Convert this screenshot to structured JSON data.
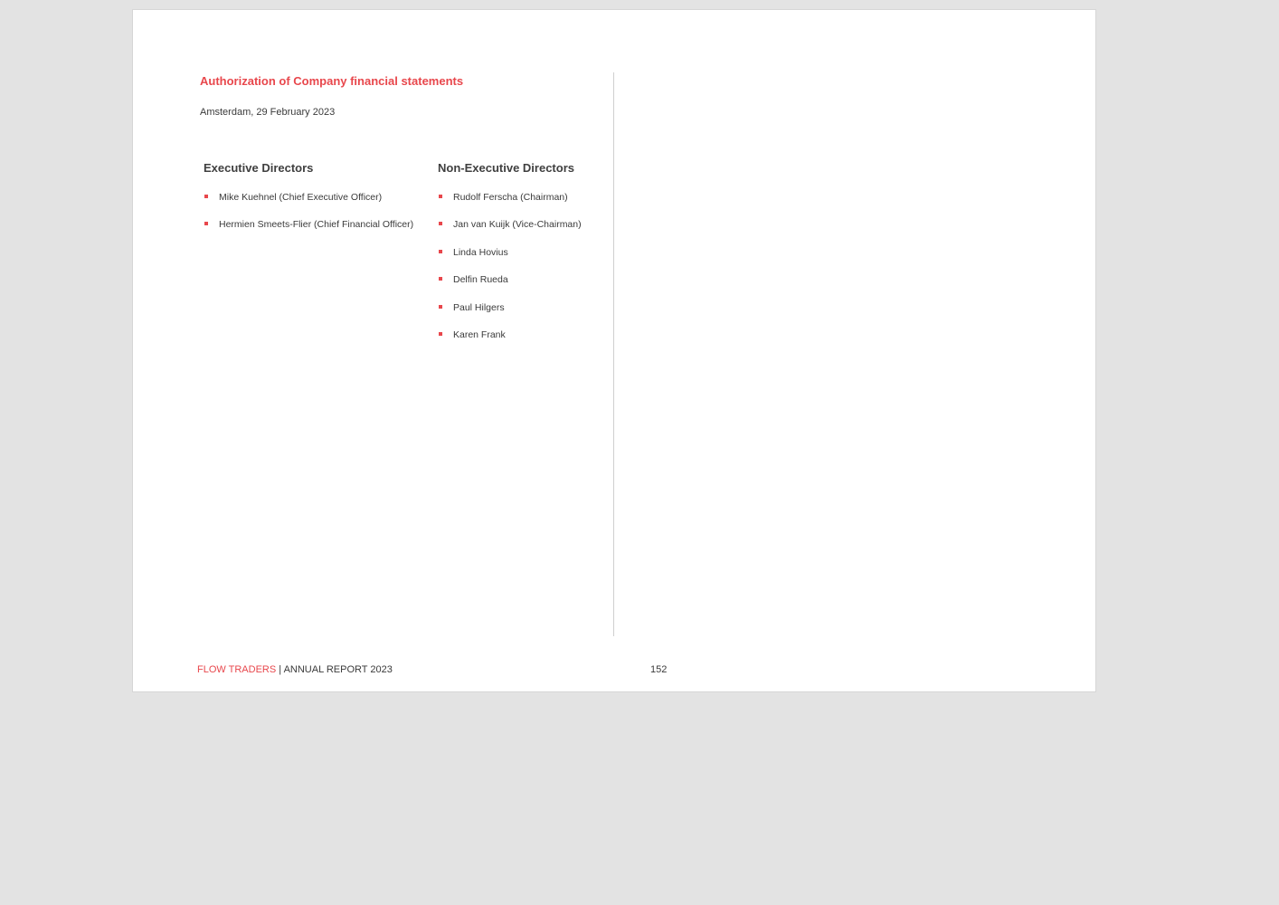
{
  "document": {
    "title": "Authorization of Company financial statements",
    "place_date": "Amsterdam, 29 February 2023"
  },
  "executive_directors": {
    "heading": "Executive Directors",
    "members": [
      "Mike Kuehnel (Chief Executive Officer)",
      "Hermien Smeets-Flier (Chief Financial Officer)"
    ]
  },
  "non_executive_directors": {
    "heading": "Non-Executive Directors",
    "members": [
      "Rudolf Ferscha (Chairman)",
      "Jan van Kuijk (Vice-Chairman)",
      "Linda Hovius",
      "Delfin Rueda",
      "Paul Hilgers",
      "Karen Frank"
    ]
  },
  "footer": {
    "brand": "FLOW TRADERS",
    "separator": " | ",
    "report": "ANNUAL REPORT 2023",
    "page_number": "152"
  },
  "colors": {
    "accent": "#e8474c",
    "text": "#3a3a3a",
    "background": "#e3e3e3",
    "page": "#ffffff"
  },
  "icons": {
    "bullet": "square-bullet-icon"
  }
}
